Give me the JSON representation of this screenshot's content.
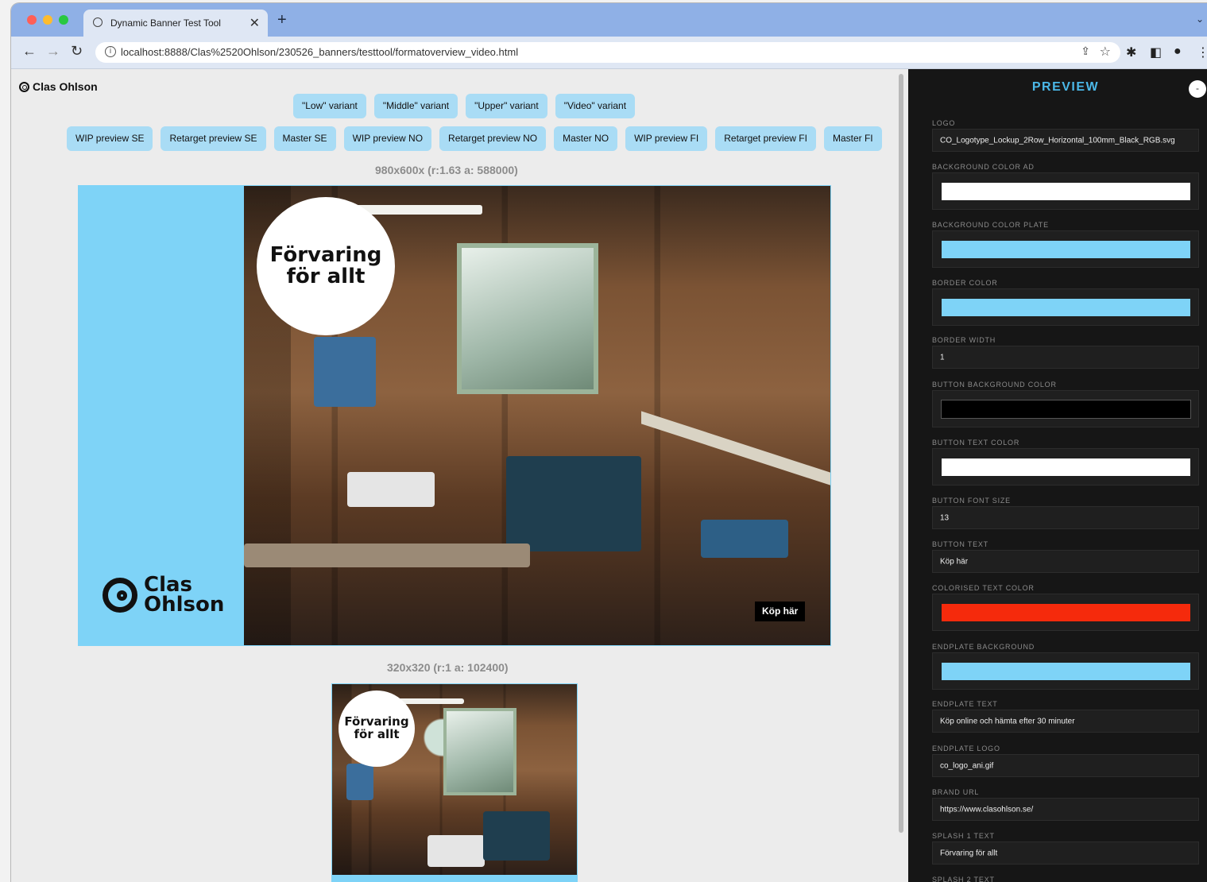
{
  "browser": {
    "tab_title": "Dynamic Banner Test Tool",
    "tab_close": "✕",
    "new_tab": "+",
    "url": "localhost:8888/Clas%2520Ohlson/230526_banners/testtool/formatoverview_video.html",
    "info_icon": "i"
  },
  "header": {
    "brand": "Clas Ohlson",
    "variant_buttons": [
      "\"Low\" variant",
      "\"Middle\" variant",
      "\"Upper\" variant",
      "\"Video\" variant"
    ],
    "preview_buttons": [
      "WIP preview SE",
      "Retarget preview SE",
      "Master SE",
      "WIP preview NO",
      "Retarget preview NO",
      "Master NO",
      "WIP preview FI",
      "Retarget preview FI",
      "Master FI"
    ]
  },
  "formats": [
    {
      "label": "980x600x (r:1.63 a: 588000)",
      "splash_line1": "Förvaring",
      "splash_line2": "för allt",
      "brand_line1": "Clas",
      "brand_line2": "Ohlson",
      "cta": "Köp här"
    },
    {
      "label": "320x320 (r:1 a: 102400)",
      "splash_line1": "Förvaring",
      "splash_line2": "för allt"
    }
  ],
  "panel": {
    "title": "PREVIEW",
    "toggle": "-",
    "fields": [
      {
        "label": "LOGO",
        "value": "CO_Logotype_Lockup_2Row_Horizontal_100mm_Black_RGB.svg"
      },
      {
        "label": "BACKGROUND COLOR AD",
        "color": "#ffffff"
      },
      {
        "label": "BACKGROUND COLOR PLATE",
        "color": "#7ed3f7"
      },
      {
        "label": "BORDER COLOR",
        "color": "#7ed3f7"
      },
      {
        "label": "BORDER WIDTH",
        "value": "1"
      },
      {
        "label": "BUTTON BACKGROUND COLOR",
        "color": "#000000"
      },
      {
        "label": "BUTTON TEXT COLOR",
        "color": "#ffffff"
      },
      {
        "label": "BUTTON FONT SIZE",
        "value": "13"
      },
      {
        "label": "BUTTON TEXT",
        "value": "Köp här"
      },
      {
        "label": "COLORISED TEXT COLOR",
        "color": "#f52a0c"
      },
      {
        "label": "ENDPLATE BACKGROUND",
        "color": "#7ed3f7"
      },
      {
        "label": "ENDPLATE TEXT",
        "value": "Köp online och hämta efter 30 minuter"
      },
      {
        "label": "ENDPLATE LOGO",
        "value": "co_logo_ani.gif"
      },
      {
        "label": "BRAND URL",
        "value": "https://www.clasohlson.se/"
      },
      {
        "label": "SPLASH 1 TEXT",
        "value": "Förvaring för allt"
      },
      {
        "label": "SPLASH 2 TEXT"
      }
    ]
  }
}
